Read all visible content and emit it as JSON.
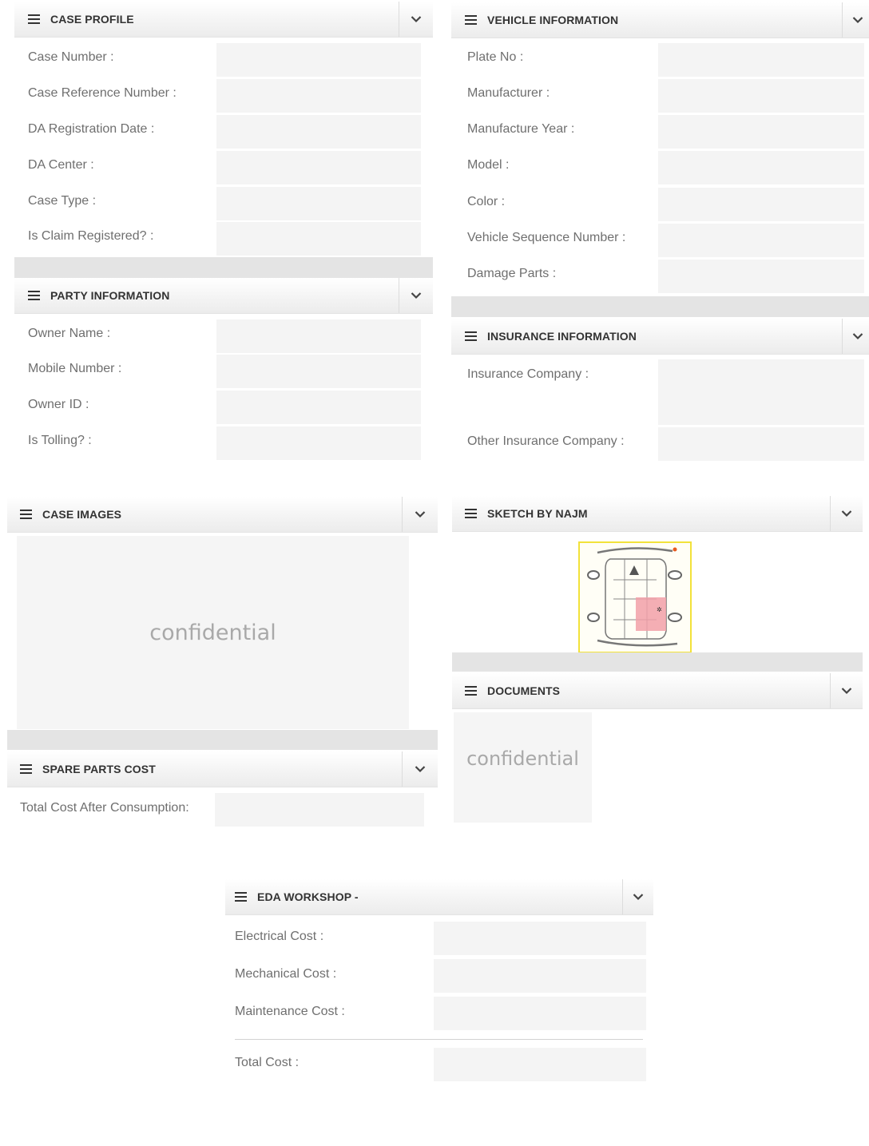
{
  "case_profile": {
    "title": "CASE PROFILE",
    "fields": [
      {
        "label": "Case Number :",
        "value": ""
      },
      {
        "label": "Case Reference Number :",
        "value": ""
      },
      {
        "label": "DA Registration Date :",
        "value": ""
      },
      {
        "label": "DA Center :",
        "value": ""
      },
      {
        "label": "Case Type :",
        "value": ""
      },
      {
        "label": "Is Claim Registered? :",
        "value": ""
      }
    ]
  },
  "party_information": {
    "title": "PARTY INFORMATION",
    "fields": [
      {
        "label": "Owner Name :",
        "value": ""
      },
      {
        "label": "Mobile Number :",
        "value": ""
      },
      {
        "label": "Owner ID :",
        "value": ""
      },
      {
        "label": "Is Tolling? :",
        "value": ""
      }
    ]
  },
  "vehicle_information": {
    "title": "VEHICLE INFORMATION",
    "fields": [
      {
        "label": "Plate No :",
        "value": ""
      },
      {
        "label": "Manufacturer :",
        "value": ""
      },
      {
        "label": "Manufacture Year :",
        "value": ""
      },
      {
        "label": "Model :",
        "value": ""
      },
      {
        "label": "Color :",
        "value": ""
      },
      {
        "label": "Vehicle Sequence Number :",
        "value": ""
      },
      {
        "label": "Damage Parts :",
        "value": ""
      }
    ]
  },
  "insurance_information": {
    "title": "INSURANCE INFORMATION",
    "fields": [
      {
        "label": "Insurance Company :",
        "value": ""
      },
      {
        "label": "Other Insurance Company :",
        "value": ""
      }
    ]
  },
  "case_images": {
    "title": "CASE IMAGES",
    "placeholder": "confidential"
  },
  "sketch": {
    "title": "SKETCH BY NAJM"
  },
  "documents": {
    "title": "DOCUMENTS",
    "placeholder": "confidential"
  },
  "spare_parts_cost": {
    "title": "SPARE PARTS COST",
    "fields": [
      {
        "label": "Total Cost After Consumption:",
        "value": ""
      }
    ]
  },
  "eda_workshop": {
    "title": "EDA WORKSHOP -",
    "fields": [
      {
        "label": "Electrical Cost :",
        "value": ""
      },
      {
        "label": "Mechanical Cost :",
        "value": ""
      },
      {
        "label": "Maintenance Cost :",
        "value": ""
      }
    ],
    "total": {
      "label": "Total Cost :",
      "value": ""
    }
  },
  "icons": {
    "menu": "hamburger-menu-icon",
    "collapse": "chevron-down-icon"
  },
  "colors": {
    "header_text": "#333333",
    "label_text": "#6f6f6f",
    "input_bg": "#f4f4f4",
    "damage_highlight": "#f2a0a8",
    "sketch_border": "#f2e23a"
  }
}
